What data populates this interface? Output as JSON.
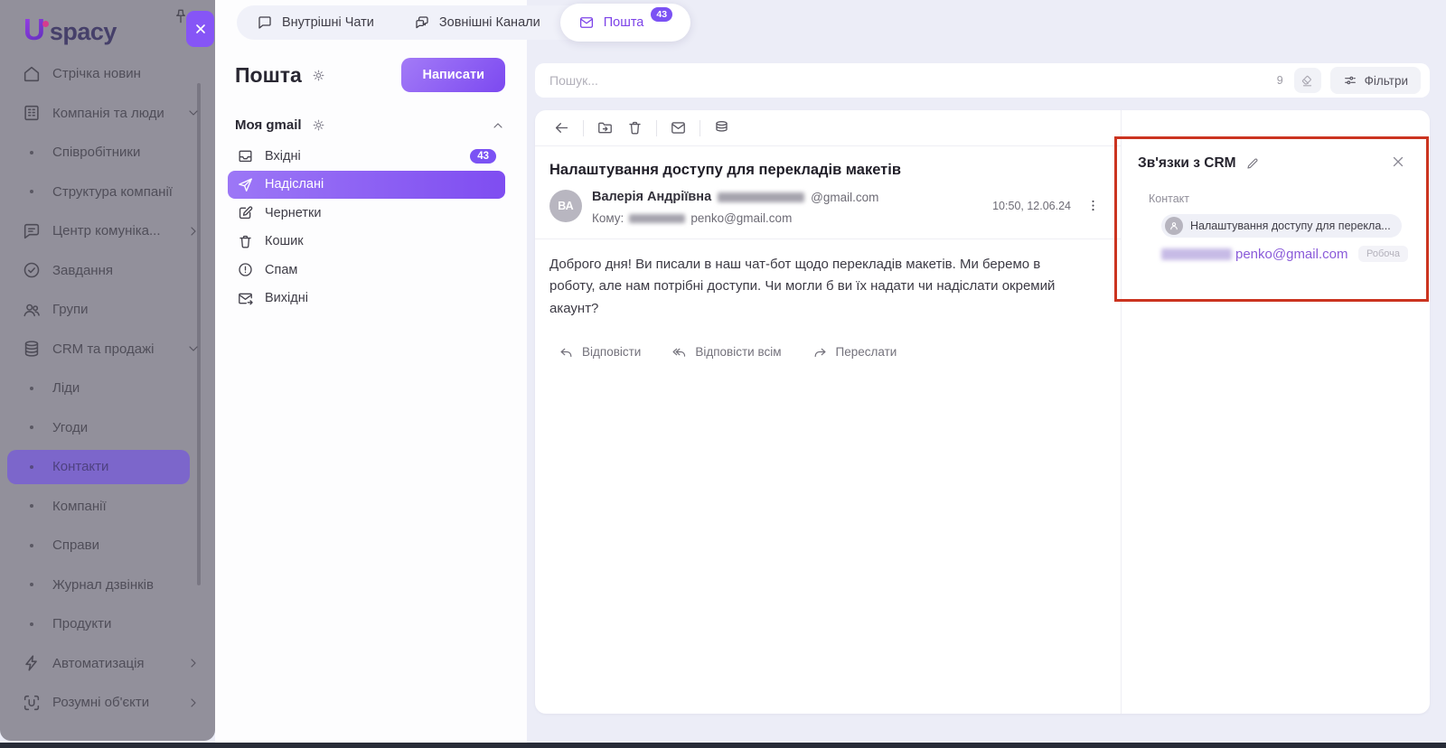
{
  "logo": {
    "letter": "U",
    "brand": "spacy"
  },
  "sidebar": {
    "items": [
      {
        "label": "Стрічка новин"
      },
      {
        "label": "Компанія та люди"
      },
      {
        "label": "Співробітники"
      },
      {
        "label": "Структура компанії"
      },
      {
        "label": "Центр комуніка..."
      },
      {
        "label": "Завдання"
      },
      {
        "label": "Групи"
      },
      {
        "label": "CRM та продажі"
      },
      {
        "label": "Ліди"
      },
      {
        "label": "Угоди"
      },
      {
        "label": "Контакти",
        "active": true
      },
      {
        "label": "Компанії"
      },
      {
        "label": "Справи"
      },
      {
        "label": "Журнал дзвінків"
      },
      {
        "label": "Продукти"
      },
      {
        "label": "Автоматизація"
      },
      {
        "label": "Розумні об'єкти"
      }
    ]
  },
  "tabs": [
    {
      "label": "Внутрішні Чати"
    },
    {
      "label": "Зовнішні Канали"
    },
    {
      "label": "Пошта",
      "badge": "43",
      "active": true
    }
  ],
  "mail_panel": {
    "title": "Пошта",
    "compose_label": "Написати",
    "account": "Моя gmail",
    "folders": [
      {
        "label": "Вхідні",
        "badge": "43"
      },
      {
        "label": "Надіслані",
        "active": true
      },
      {
        "label": "Чернетки"
      },
      {
        "label": "Кошик"
      },
      {
        "label": "Спам"
      },
      {
        "label": "Вихідні"
      }
    ]
  },
  "search": {
    "placeholder": "Пошук...",
    "count": "9",
    "filters_label": "Фільтри"
  },
  "email": {
    "subject": "Налаштування доступу для перекладів макетів",
    "avatar_initials": "ВА",
    "sender_name": "Валерія Андріївна",
    "sender_email_domain": "@gmail.com",
    "to_label": "Кому:",
    "to_email_visible": "penko@gmail.com",
    "datetime": "10:50, 12.06.24",
    "body_paragraph": "Доброго дня! Ви писали в наш чат-бот щодо перекладів макетів. Ми беремо в роботу, але нам потрібні доступи. Чи могли б ви їх надати чи надіслати окремий акаунт?",
    "actions": [
      {
        "label": "Відповісти"
      },
      {
        "label": "Відповісти всім"
      },
      {
        "label": "Переслати"
      }
    ]
  },
  "crm_panel": {
    "title": "Зв'язки з CRM",
    "section_label": "Контакт",
    "contact_chip": "Налаштування доступу для перекла...",
    "contact_email_visible": "penko@gmail.com",
    "email_type_label": "Робоча"
  }
}
